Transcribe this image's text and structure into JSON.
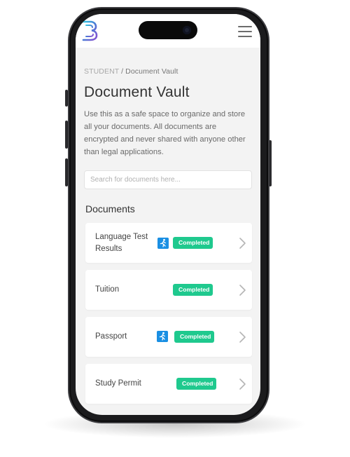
{
  "colors": {
    "accent_green": "#1fc98e",
    "icon_blue": "#1a8fe3",
    "background": "#f3f3f3",
    "text_dark": "#333333"
  },
  "header": {
    "logo_icon": "brand-logo-icon",
    "menu_icon": "hamburger-menu-icon"
  },
  "breadcrumb": {
    "root": "STUDENT",
    "separator": " / ",
    "current": "Document Vault"
  },
  "page": {
    "title": "Document Vault",
    "description": "Use this as a safe space to organize and store all your documents. All documents are encrypted and never shared with anyone other than legal applications."
  },
  "search": {
    "placeholder": "Search for documents here...",
    "value": ""
  },
  "documents": {
    "heading": "Documents",
    "items": [
      {
        "name": "Language Test Results",
        "status": "Completed",
        "icon": "running-person-icon"
      },
      {
        "name": "Tuition",
        "status": "Completed"
      },
      {
        "name": "Passport",
        "status": "Completed",
        "icon": "running-person-icon"
      },
      {
        "name": "Study Permit",
        "status": "Completed"
      }
    ]
  }
}
